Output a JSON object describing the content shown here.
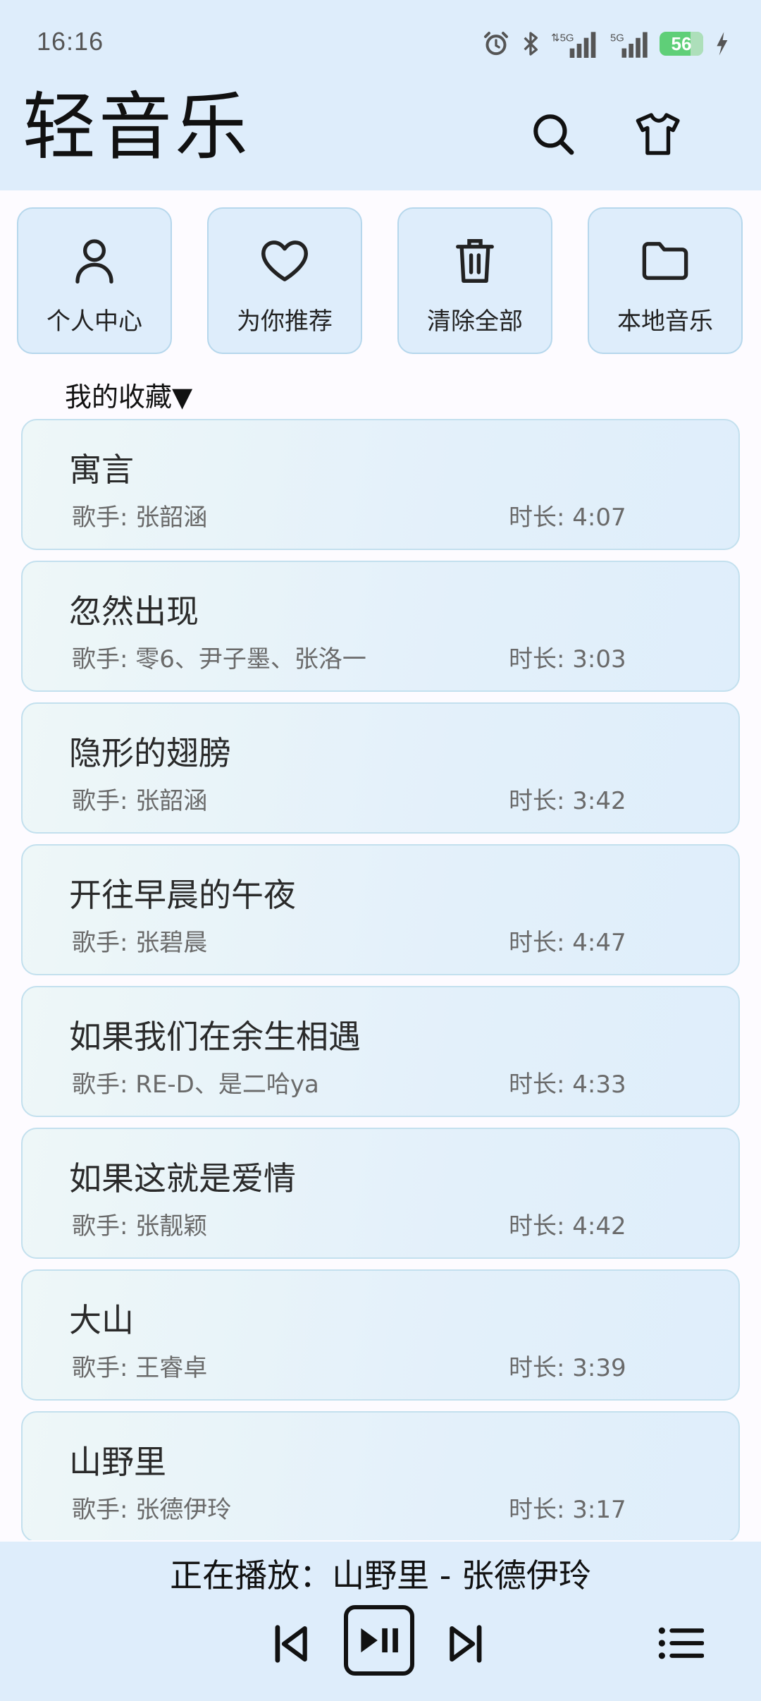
{
  "status_bar": {
    "time": "16:16",
    "battery": "56",
    "icons": [
      "alarm-icon",
      "bluetooth-icon",
      "signal-5g-icon",
      "signal-5g-icon",
      "battery-icon",
      "charging-icon"
    ]
  },
  "header": {
    "title": "轻音乐",
    "icons": [
      "search-icon",
      "tshirt-icon"
    ]
  },
  "actions": [
    {
      "label": "个人中心",
      "icon": "user-icon"
    },
    {
      "label": "为你推荐",
      "icon": "heart-icon"
    },
    {
      "label": "清除全部",
      "icon": "trash-icon"
    },
    {
      "label": "本地音乐",
      "icon": "folder-icon"
    }
  ],
  "section": {
    "title": "我的收藏▼"
  },
  "songs": [
    {
      "title": "寓言",
      "artist": "歌手: 张韶涵",
      "duration": "时长: 4:07"
    },
    {
      "title": "忽然出现",
      "artist": "歌手: 零6、尹子墨、张洛一",
      "duration": "时长: 3:03"
    },
    {
      "title": "隐形的翅膀",
      "artist": "歌手: 张韶涵",
      "duration": "时长: 3:42"
    },
    {
      "title": "开往早晨的午夜",
      "artist": "歌手: 张碧晨",
      "duration": "时长: 4:47"
    },
    {
      "title": "如果我们在余生相遇",
      "artist": "歌手: RE-D、是二哈ya",
      "duration": "时长: 4:33"
    },
    {
      "title": "如果这就是爱情",
      "artist": "歌手: 张靓颖",
      "duration": "时长: 4:42"
    },
    {
      "title": "大山",
      "artist": "歌手: 王睿卓",
      "duration": "时长: 3:39"
    },
    {
      "title": "山野里",
      "artist": "歌手: 张德伊玲",
      "duration": "时长: 3:17"
    }
  ],
  "player": {
    "now_playing": "正在播放：山野里 - 张德伊玲",
    "icons": [
      "previous-icon",
      "play-pause-icon",
      "next-icon",
      "playlist-icon"
    ]
  },
  "colors": {
    "header_bg": "#deedfb",
    "card_border": "#b6d7ec",
    "page_bg": "#fdfbff",
    "battery": "#5fcf78"
  }
}
